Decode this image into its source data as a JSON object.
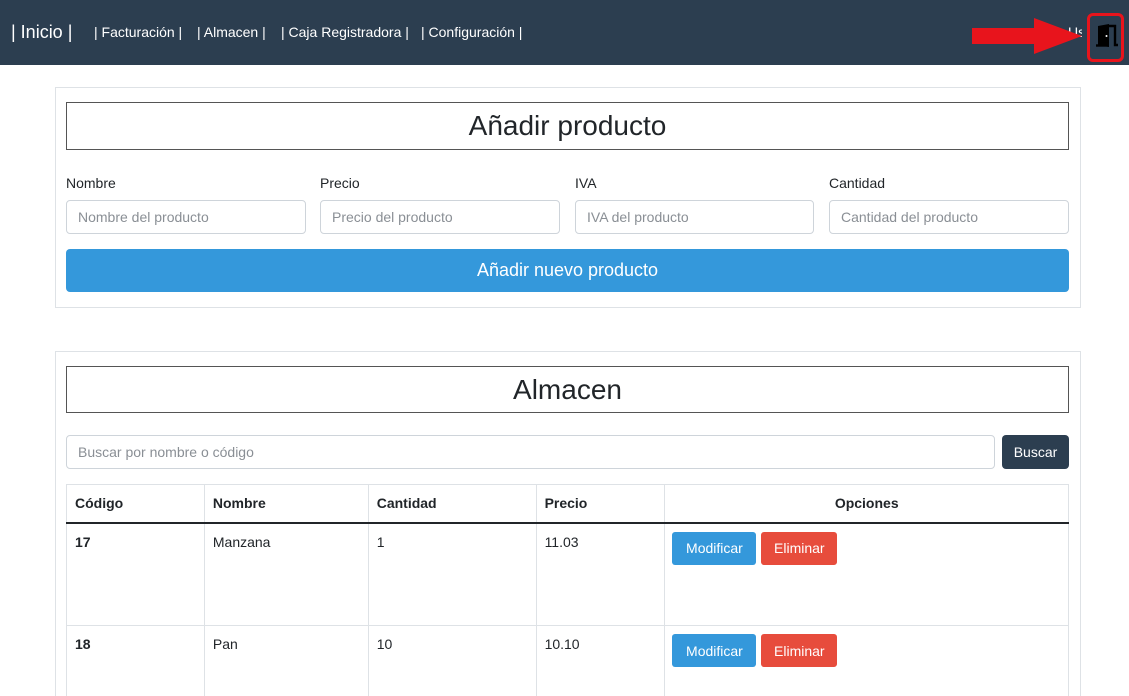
{
  "nav": {
    "brand": "| Inicio |",
    "links": [
      "| Facturación |",
      "| Almacen |",
      "| Caja Registradora |",
      "| Configuración |"
    ],
    "user_truncated": "Usuario",
    "logout_icon": "door-icon",
    "annotation_color": "#e8141c"
  },
  "add_product": {
    "title": "Añadir producto",
    "fields": [
      {
        "label": "Nombre",
        "placeholder": "Nombre del producto"
      },
      {
        "label": "Precio",
        "placeholder": "Precio del producto"
      },
      {
        "label": "IVA",
        "placeholder": "IVA del producto"
      },
      {
        "label": "Cantidad",
        "placeholder": "Cantidad del producto"
      }
    ],
    "submit_label": "Añadir nuevo producto"
  },
  "warehouse": {
    "title": "Almacen",
    "search_placeholder": "Buscar por nombre o código",
    "search_label": "Buscar",
    "columns": [
      "Código",
      "Nombre",
      "Cantidad",
      "Precio",
      "Opciones"
    ],
    "rows": [
      {
        "code": "17",
        "name": "Manzana",
        "qty": "1",
        "price": "11.03"
      },
      {
        "code": "18",
        "name": "Pan",
        "qty": "10",
        "price": "10.10"
      }
    ],
    "modify_label": "Modificar",
    "delete_label": "Eliminar"
  },
  "colors": {
    "navbar": "#2c3e50",
    "primary": "#3498db",
    "danger": "#e74c3c"
  }
}
